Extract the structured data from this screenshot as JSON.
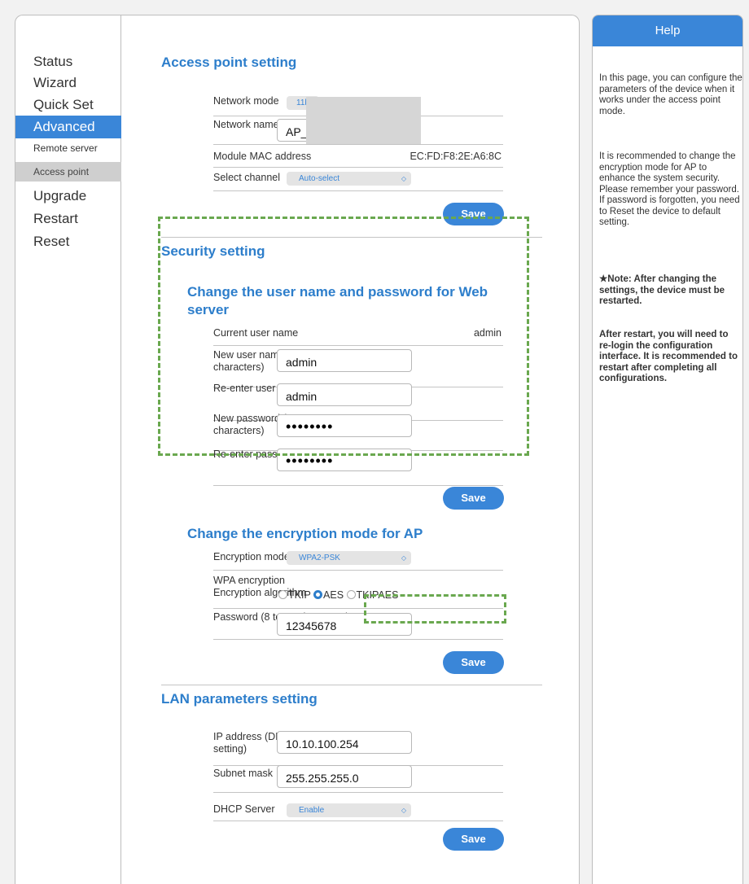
{
  "sidebar": {
    "items": [
      {
        "label": "Status"
      },
      {
        "label": "Wizard"
      },
      {
        "label": "Quick Set"
      },
      {
        "label": "Advanced"
      },
      {
        "label": "Remote server"
      },
      {
        "label": "Access point"
      },
      {
        "label": "Upgrade"
      },
      {
        "label": "Restart"
      },
      {
        "label": "Reset"
      }
    ]
  },
  "access_point": {
    "title": "Access point setting",
    "network_mode_label": "Network mode",
    "network_mode_value": "11b",
    "ssid_label": "Network name(SSID)",
    "ssid_value": "AP_",
    "mac_label": "Module MAC address",
    "mac_value": "EC:FD:F8:2E:A6:8C",
    "channel_label": "Select channel",
    "channel_value": "Auto-select",
    "save": "Save"
  },
  "security": {
    "title": "Security setting",
    "subtitle": "Change the user name and password for Web server",
    "current_user_label": "Current user name",
    "current_user_value": "admin",
    "new_user_label": "New user name (Max.15 characters)",
    "new_user_value": "admin",
    "reenter_user_label": "Re-enter user name",
    "reenter_user_value": "admin",
    "new_pass_label": "New password (Max.15 characters)",
    "new_pass_value": "••••••••",
    "reenter_pass_label": "Re-enter password",
    "reenter_pass_value": "••••••••",
    "save": "Save"
  },
  "encryption": {
    "title": "Change the encryption mode for AP",
    "mode_label": "Encryption mode",
    "mode_value": "WPA2-PSK",
    "wpa_label": "WPA encryption",
    "algo_label": "Encryption algorithm",
    "options": [
      "TKIP",
      "AES",
      "TKIPAES"
    ],
    "selected": "AES",
    "password_label": "Password (8 to 63 characters)",
    "password_value": "12345678",
    "save": "Save"
  },
  "lan": {
    "title": "LAN parameters setting",
    "ip_label": "IP address (DHCP gateway setting)",
    "ip_value": "10.10.100.254",
    "mask_label": "Subnet mask",
    "mask_value": "255.255.255.0",
    "dhcp_label": "DHCP Server",
    "dhcp_value": "Enable",
    "save": "Save"
  },
  "help": {
    "title": "Help",
    "p1": "In this page, you can configure the parameters of the device when it works under the access point mode.",
    "p2": "It is recommended to change the encryption mode for AP to enhance the system security. Please remember your password. If password is forgotten, you need to Reset the device to default setting.",
    "p3": "★Note: After changing the settings, the device must be restarted.",
    "p4": "After restart, you will need to re-login the configuration interface. It is recommended to restart after completing all configurations."
  },
  "colors": {
    "accent": "#3a86d8",
    "highlight_dash": "#6aa84f"
  }
}
